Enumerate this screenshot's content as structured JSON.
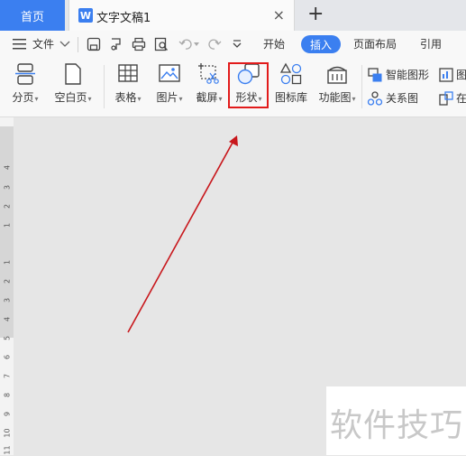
{
  "tabs": {
    "home": "首页",
    "doc_title": "文字文稿1",
    "doc_icon_letter": "W",
    "close": "×",
    "add": "+"
  },
  "menu": {
    "file": "文件",
    "start": "开始",
    "insert": "插入",
    "page_layout": "页面布局",
    "references": "引用"
  },
  "ribbon": {
    "page_break": "分页",
    "blank_page": "空白页",
    "table": "表格",
    "picture": "图片",
    "screenshot": "截屏",
    "shape": "形状",
    "icon_library": "图标库",
    "function_chart": "功能图",
    "smart_art": "智能图形",
    "relation_chart": "关系图",
    "chart_partial": "图",
    "online_partial": "在"
  },
  "ruler": [
    "4",
    "3",
    "2",
    "1",
    "1",
    "2",
    "3",
    "4",
    "5",
    "6",
    "7",
    "8",
    "9",
    "10",
    "11"
  ],
  "watermark": "软件技巧",
  "colors": {
    "accent": "#3b7ff0",
    "highlight": "#e21b1b",
    "arrow": "#c8171c"
  }
}
